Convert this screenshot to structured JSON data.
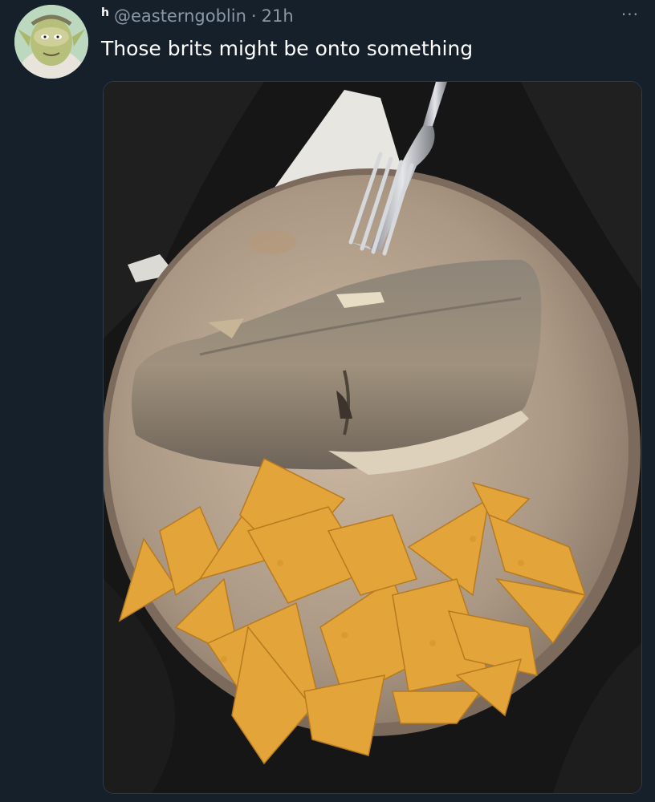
{
  "tweet": {
    "name_initial": "h",
    "handle": "@easterngoblin",
    "separator": "·",
    "time": "21h",
    "more_icon": "···",
    "text": "Those brits might be onto something"
  },
  "media": {
    "description_icon": "photo-image"
  }
}
